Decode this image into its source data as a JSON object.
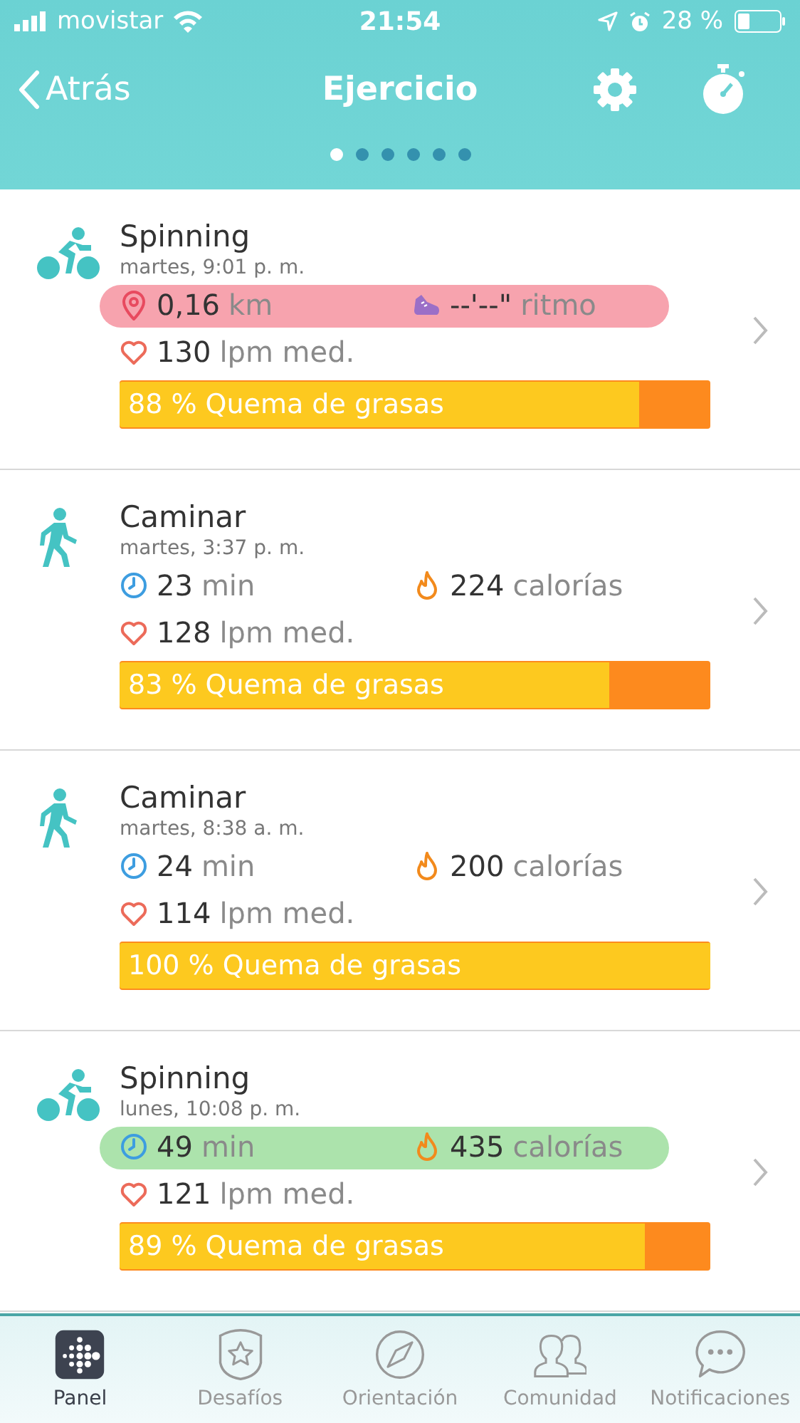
{
  "status_bar": {
    "carrier": "movistar",
    "time": "21:54",
    "battery": "28 %"
  },
  "nav": {
    "back": "Atrás",
    "title": "Ejercicio",
    "pages": [
      {
        "selected": true
      },
      {
        "selected": false
      },
      {
        "selected": false
      },
      {
        "selected": false
      },
      {
        "selected": false
      },
      {
        "selected": false
      }
    ]
  },
  "exercises": [
    {
      "kind": "bike",
      "name": "Spinning",
      "date": "martes, 9:01 p. m.",
      "highlight": {
        "color": "#f7a3ae"
      },
      "stats": [
        {
          "kind": "distance",
          "value": "0,16",
          "unit": "km"
        },
        {
          "kind": "pace",
          "value": "--'--\"",
          "unit": "ritmo"
        }
      ],
      "heart": {
        "value": "130",
        "unit": "lpm med."
      },
      "fat_burn": {
        "label": "88 % Quema de grasas",
        "level": 0.88
      }
    },
    {
      "kind": "walk",
      "name": "Caminar",
      "date": "martes, 3:37 p. m.",
      "stats": [
        {
          "kind": "duration",
          "value": "23",
          "unit": "min"
        },
        {
          "kind": "calories",
          "value": "224",
          "unit": "calorías"
        }
      ],
      "heart": {
        "value": "128",
        "unit": "lpm med."
      },
      "fat_burn": {
        "label": "83 % Quema de grasas",
        "level": 0.83
      }
    },
    {
      "kind": "walk",
      "name": "Caminar",
      "date": "martes, 8:38 a. m.",
      "stats": [
        {
          "kind": "duration",
          "value": "24",
          "unit": "min"
        },
        {
          "kind": "calories",
          "value": "200",
          "unit": "calorías"
        }
      ],
      "heart": {
        "value": "114",
        "unit": "lpm med."
      },
      "fat_burn": {
        "label": "100 % Quema de grasas",
        "level": 1
      }
    },
    {
      "kind": "bike",
      "name": "Spinning",
      "date": "lunes, 10:08 p. m.",
      "highlight": {
        "color": "#ace3ac"
      },
      "stats": [
        {
          "kind": "duration",
          "value": "49",
          "unit": "min"
        },
        {
          "kind": "calories",
          "value": "435",
          "unit": "calorías"
        }
      ],
      "heart": {
        "value": "121",
        "unit": "lpm med."
      },
      "fat_burn": {
        "label": "89 % Quema de grasas",
        "level": 0.89
      }
    }
  ],
  "tabs": [
    {
      "label": "Panel",
      "selected": true
    },
    {
      "label": "Desafíos",
      "selected": false
    },
    {
      "label": "Orientación",
      "selected": false
    },
    {
      "label": "Comunidad",
      "selected": false
    },
    {
      "label": "Notificaciones",
      "selected": false
    }
  ]
}
